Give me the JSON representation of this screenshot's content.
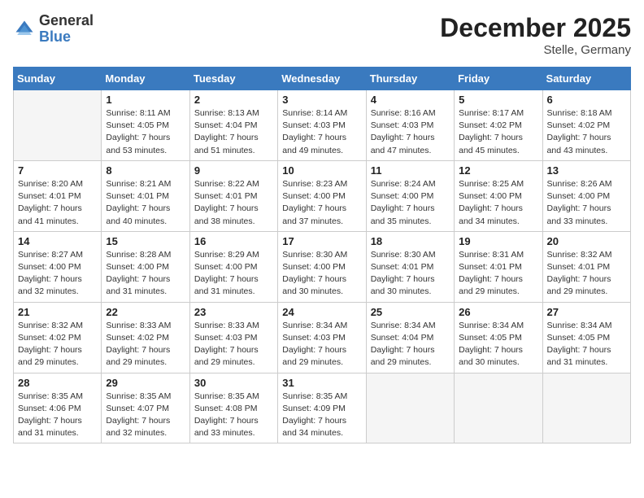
{
  "header": {
    "logo_general": "General",
    "logo_blue": "Blue",
    "title": "December 2025",
    "subtitle": "Stelle, Germany"
  },
  "days_of_week": [
    "Sunday",
    "Monday",
    "Tuesday",
    "Wednesday",
    "Thursday",
    "Friday",
    "Saturday"
  ],
  "weeks": [
    [
      {
        "day": "",
        "sunrise": "",
        "sunset": "",
        "daylight": ""
      },
      {
        "day": "1",
        "sunrise": "Sunrise: 8:11 AM",
        "sunset": "Sunset: 4:05 PM",
        "daylight": "Daylight: 7 hours and 53 minutes."
      },
      {
        "day": "2",
        "sunrise": "Sunrise: 8:13 AM",
        "sunset": "Sunset: 4:04 PM",
        "daylight": "Daylight: 7 hours and 51 minutes."
      },
      {
        "day": "3",
        "sunrise": "Sunrise: 8:14 AM",
        "sunset": "Sunset: 4:03 PM",
        "daylight": "Daylight: 7 hours and 49 minutes."
      },
      {
        "day": "4",
        "sunrise": "Sunrise: 8:16 AM",
        "sunset": "Sunset: 4:03 PM",
        "daylight": "Daylight: 7 hours and 47 minutes."
      },
      {
        "day": "5",
        "sunrise": "Sunrise: 8:17 AM",
        "sunset": "Sunset: 4:02 PM",
        "daylight": "Daylight: 7 hours and 45 minutes."
      },
      {
        "day": "6",
        "sunrise": "Sunrise: 8:18 AM",
        "sunset": "Sunset: 4:02 PM",
        "daylight": "Daylight: 7 hours and 43 minutes."
      }
    ],
    [
      {
        "day": "7",
        "sunrise": "Sunrise: 8:20 AM",
        "sunset": "Sunset: 4:01 PM",
        "daylight": "Daylight: 7 hours and 41 minutes."
      },
      {
        "day": "8",
        "sunrise": "Sunrise: 8:21 AM",
        "sunset": "Sunset: 4:01 PM",
        "daylight": "Daylight: 7 hours and 40 minutes."
      },
      {
        "day": "9",
        "sunrise": "Sunrise: 8:22 AM",
        "sunset": "Sunset: 4:01 PM",
        "daylight": "Daylight: 7 hours and 38 minutes."
      },
      {
        "day": "10",
        "sunrise": "Sunrise: 8:23 AM",
        "sunset": "Sunset: 4:00 PM",
        "daylight": "Daylight: 7 hours and 37 minutes."
      },
      {
        "day": "11",
        "sunrise": "Sunrise: 8:24 AM",
        "sunset": "Sunset: 4:00 PM",
        "daylight": "Daylight: 7 hours and 35 minutes."
      },
      {
        "day": "12",
        "sunrise": "Sunrise: 8:25 AM",
        "sunset": "Sunset: 4:00 PM",
        "daylight": "Daylight: 7 hours and 34 minutes."
      },
      {
        "day": "13",
        "sunrise": "Sunrise: 8:26 AM",
        "sunset": "Sunset: 4:00 PM",
        "daylight": "Daylight: 7 hours and 33 minutes."
      }
    ],
    [
      {
        "day": "14",
        "sunrise": "Sunrise: 8:27 AM",
        "sunset": "Sunset: 4:00 PM",
        "daylight": "Daylight: 7 hours and 32 minutes."
      },
      {
        "day": "15",
        "sunrise": "Sunrise: 8:28 AM",
        "sunset": "Sunset: 4:00 PM",
        "daylight": "Daylight: 7 hours and 31 minutes."
      },
      {
        "day": "16",
        "sunrise": "Sunrise: 8:29 AM",
        "sunset": "Sunset: 4:00 PM",
        "daylight": "Daylight: 7 hours and 31 minutes."
      },
      {
        "day": "17",
        "sunrise": "Sunrise: 8:30 AM",
        "sunset": "Sunset: 4:00 PM",
        "daylight": "Daylight: 7 hours and 30 minutes."
      },
      {
        "day": "18",
        "sunrise": "Sunrise: 8:30 AM",
        "sunset": "Sunset: 4:01 PM",
        "daylight": "Daylight: 7 hours and 30 minutes."
      },
      {
        "day": "19",
        "sunrise": "Sunrise: 8:31 AM",
        "sunset": "Sunset: 4:01 PM",
        "daylight": "Daylight: 7 hours and 29 minutes."
      },
      {
        "day": "20",
        "sunrise": "Sunrise: 8:32 AM",
        "sunset": "Sunset: 4:01 PM",
        "daylight": "Daylight: 7 hours and 29 minutes."
      }
    ],
    [
      {
        "day": "21",
        "sunrise": "Sunrise: 8:32 AM",
        "sunset": "Sunset: 4:02 PM",
        "daylight": "Daylight: 7 hours and 29 minutes."
      },
      {
        "day": "22",
        "sunrise": "Sunrise: 8:33 AM",
        "sunset": "Sunset: 4:02 PM",
        "daylight": "Daylight: 7 hours and 29 minutes."
      },
      {
        "day": "23",
        "sunrise": "Sunrise: 8:33 AM",
        "sunset": "Sunset: 4:03 PM",
        "daylight": "Daylight: 7 hours and 29 minutes."
      },
      {
        "day": "24",
        "sunrise": "Sunrise: 8:34 AM",
        "sunset": "Sunset: 4:03 PM",
        "daylight": "Daylight: 7 hours and 29 minutes."
      },
      {
        "day": "25",
        "sunrise": "Sunrise: 8:34 AM",
        "sunset": "Sunset: 4:04 PM",
        "daylight": "Daylight: 7 hours and 29 minutes."
      },
      {
        "day": "26",
        "sunrise": "Sunrise: 8:34 AM",
        "sunset": "Sunset: 4:05 PM",
        "daylight": "Daylight: 7 hours and 30 minutes."
      },
      {
        "day": "27",
        "sunrise": "Sunrise: 8:34 AM",
        "sunset": "Sunset: 4:05 PM",
        "daylight": "Daylight: 7 hours and 31 minutes."
      }
    ],
    [
      {
        "day": "28",
        "sunrise": "Sunrise: 8:35 AM",
        "sunset": "Sunset: 4:06 PM",
        "daylight": "Daylight: 7 hours and 31 minutes."
      },
      {
        "day": "29",
        "sunrise": "Sunrise: 8:35 AM",
        "sunset": "Sunset: 4:07 PM",
        "daylight": "Daylight: 7 hours and 32 minutes."
      },
      {
        "day": "30",
        "sunrise": "Sunrise: 8:35 AM",
        "sunset": "Sunset: 4:08 PM",
        "daylight": "Daylight: 7 hours and 33 minutes."
      },
      {
        "day": "31",
        "sunrise": "Sunrise: 8:35 AM",
        "sunset": "Sunset: 4:09 PM",
        "daylight": "Daylight: 7 hours and 34 minutes."
      },
      {
        "day": "",
        "sunrise": "",
        "sunset": "",
        "daylight": ""
      },
      {
        "day": "",
        "sunrise": "",
        "sunset": "",
        "daylight": ""
      },
      {
        "day": "",
        "sunrise": "",
        "sunset": "",
        "daylight": ""
      }
    ]
  ]
}
